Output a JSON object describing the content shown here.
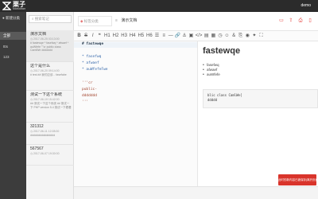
{
  "app": {
    "logo_text": "栗子",
    "logo_sub": "Markdown",
    "user": "demo",
    "logo_color": "#ffffff"
  },
  "sidebar": {
    "new_label": "● 新建分类",
    "items": [
      {
        "label": "全部",
        "active": true
      },
      {
        "label": "ttts",
        "active": false
      },
      {
        "label": "123",
        "active": false
      }
    ]
  },
  "note_list": {
    "search_placeholder": "搜索笔记",
    "notes": [
      {
        "title": "演示文档",
        "meta": "◷ 2017-06-25 03:13:00",
        "snippet": "# fastewqe * fasefwq * afwaef * auWfefe ''''cr public class CamlWe ddddddd",
        "selected": true
      },
      {
        "title": "这个是什么",
        "meta": "◷ 2017-06-20 09:14:00",
        "snippet": "# test ## 我们应该... fasefabe",
        "selected": false
      },
      {
        "title": "测试一下这个系统",
        "meta": "◷ 2017-06-19 15:42:00",
        "snippet": "## 测试一下这个系统 ## 测试一下 PHP version 5.4 测试一下看看",
        "selected": false
      },
      {
        "title": "321312",
        "meta": "◷ 2017-06-11 12:28:00",
        "snippet": "dddddddddddddddd",
        "selected": false
      },
      {
        "title": "567567",
        "meta": "◷ 2017-06-07 19:30:00",
        "snippet": "",
        "selected": false
      }
    ]
  },
  "titlebar": {
    "notebook": "标签分类",
    "title": "演示文档",
    "icons": [
      "save-icon",
      "export-icon",
      "print-icon",
      "delete-icon",
      "fullscreen-icon"
    ]
  },
  "format_toolbar": {
    "buttons": [
      {
        "name": "bold-button",
        "label": "B"
      },
      {
        "name": "strike-button",
        "label": "S"
      },
      {
        "name": "italic-button",
        "label": "I"
      },
      {
        "name": "quote-button",
        "label": "❝"
      },
      {
        "name": "h1-button",
        "label": "H1"
      },
      {
        "name": "h2-button",
        "label": "H2"
      },
      {
        "name": "h3-button",
        "label": "H3"
      },
      {
        "name": "h4-button",
        "label": "H4"
      },
      {
        "name": "h5-button",
        "label": "H5"
      },
      {
        "name": "h6-button",
        "label": "H6"
      },
      {
        "name": "ul-button",
        "label": "☰"
      },
      {
        "name": "ol-button",
        "label": "≡"
      },
      {
        "name": "hr-button",
        "label": "—"
      },
      {
        "name": "link-button",
        "label": "🔗"
      },
      {
        "name": "anchor-button",
        "label": "⚓"
      },
      {
        "name": "image-button",
        "label": "▣"
      },
      {
        "name": "code-button",
        "label": "</>"
      },
      {
        "name": "codeblock-button",
        "label": "▤"
      },
      {
        "name": "table-button",
        "label": "▦"
      },
      {
        "name": "datetime-button",
        "label": "◷"
      },
      {
        "name": "emoji-button",
        "label": "☺"
      },
      {
        "name": "entity-button",
        "label": "&"
      },
      {
        "name": "pagebreak-button",
        "label": "⎘"
      },
      {
        "name": "watch-button",
        "label": "◉"
      },
      {
        "name": "preview-button",
        "label": "✦"
      },
      {
        "name": "fullscreen-button",
        "label": "⛶"
      }
    ]
  },
  "editor": {
    "lines": [
      {
        "text": "# fastewqe",
        "kind": "head"
      },
      {
        "text": "",
        "kind": "plain"
      },
      {
        "text": "* fasefwq",
        "kind": "list"
      },
      {
        "text": "* afwaef",
        "kind": "list"
      },
      {
        "text": "* auWfefeFwe",
        "kind": "list"
      },
      {
        "text": "",
        "kind": "plain"
      },
      {
        "text": "'''cr",
        "kind": "code"
      },
      {
        "text": "public-",
        "kind": "code"
      },
      {
        "text": "ddddddd",
        "kind": "code"
      },
      {
        "text": "'''",
        "kind": "code"
      }
    ]
  },
  "preview": {
    "heading": "fastewqe",
    "list": [
      "fasefwq",
      "afwaef",
      "auWfefe"
    ],
    "code_lines": [
      "blic class CamlWe{",
      "ddddd"
    ]
  },
  "toast": {
    "text": "此时的新内容已被保存(离开页面)"
  }
}
